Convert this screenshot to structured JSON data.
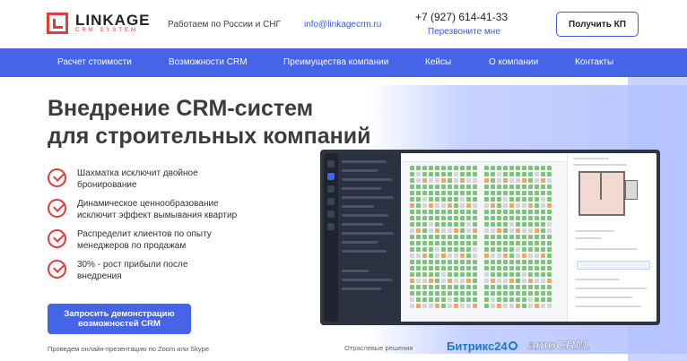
{
  "header": {
    "logo": {
      "name": "LINKAGE",
      "subtitle": "CRM SYSTEM"
    },
    "work_region": "Работаем по России и СНГ",
    "email": "info@linkagecrm.ru",
    "phone": "+7 (927) 614-41-33",
    "callback_link": "Перезвоните мне",
    "cta_button": "Получить КП"
  },
  "nav": {
    "items": [
      {
        "label": "Расчет стоимости"
      },
      {
        "label": "Возможности CRM"
      },
      {
        "label": "Преимущества компании"
      },
      {
        "label": "Кейсы"
      },
      {
        "label": "О компании"
      },
      {
        "label": "Контакты"
      }
    ]
  },
  "hero": {
    "title_line1": "Внедрение CRM-систем",
    "title_line2": "для строительных компаний",
    "features": [
      {
        "text": "Шахматка исключит двойное бронирование"
      },
      {
        "text": "Динамическое ценнообразование исключит эффект вымывания квартир"
      },
      {
        "text": "Распределит клиентов по опыту менеджеров по продажам"
      },
      {
        "text": "30% - рост прибыли после внедрения"
      }
    ],
    "demo_button": "Запросить демонстрацию возможностей CRM",
    "footnote": "Проведем онлайн-презентацию по Zoom или Skype"
  },
  "partners": {
    "label": "Отраслевые решения",
    "bitrix": "Битрикс24",
    "amo": "amoCRM."
  },
  "colors": {
    "accent": "#4664e8",
    "brand_red": "#e23b3b",
    "cell_green": "#7cc47a",
    "cell_gray": "#d3d7dc",
    "cell_orange": "#f0a85a"
  }
}
